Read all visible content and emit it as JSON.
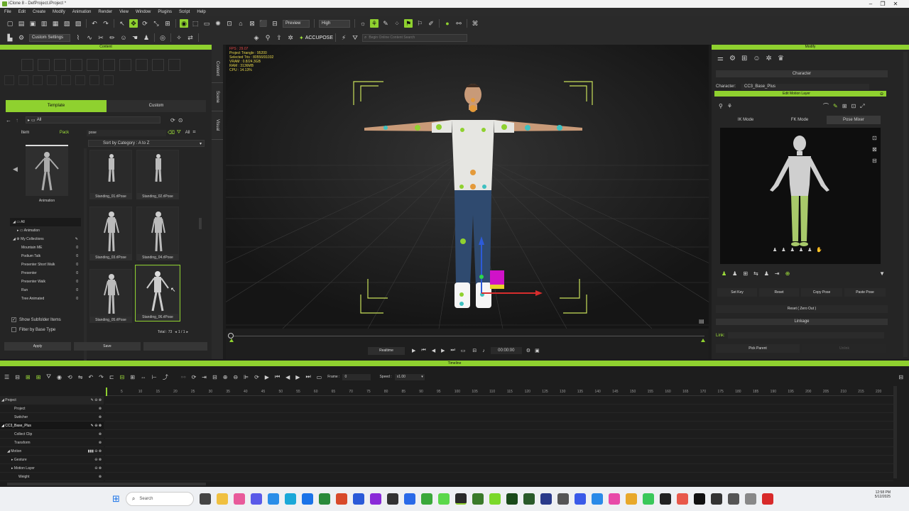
{
  "app": {
    "title": "iClone 8 - DefProject.iProject *",
    "window_controls": [
      "–",
      "❐",
      "✕"
    ]
  },
  "menu": [
    "File",
    "Edit",
    "Create",
    "Modify",
    "Animation",
    "Render",
    "View",
    "Window",
    "Plugins",
    "Script",
    "Help"
  ],
  "toolbar1": {
    "preview_label": "Preview",
    "quality_label": "High"
  },
  "toolbar2": {
    "settings_label": "Custom Settings",
    "accupose_label": "ACCUPOSE",
    "search_placeholder": "Begin Online Content Search"
  },
  "content": {
    "header": "Content",
    "tab_template": "Template",
    "tab_custom": "Custom",
    "path": "All",
    "filter_item": "Item",
    "filter_pack": "Pack",
    "search_value": "pose",
    "all_label": "All",
    "sort_label": "Sort by Category : A to Z",
    "preview_caption": "Animation",
    "tree": [
      {
        "label": "All",
        "count": ""
      },
      {
        "label": "Animation",
        "count": ""
      },
      {
        "label": "My Collections",
        "count": ""
      },
      {
        "label": "Mountain ME",
        "count": "0"
      },
      {
        "label": "Podium Talk",
        "count": "0"
      },
      {
        "label": "Presenter Short Walk",
        "count": "0"
      },
      {
        "label": "Presenter",
        "count": "0"
      },
      {
        "label": "Presenter Walk",
        "count": "0"
      },
      {
        "label": "Run",
        "count": "0"
      },
      {
        "label": "Tree Animated",
        "count": "0"
      }
    ],
    "items": [
      "Standing_01.rlPose",
      "Standing_02.rlPose",
      "Standing_03.rlPose",
      "Standing_04.rlPose",
      "Standing_05.rlPose",
      "Standing_06.rlPose"
    ],
    "show_subfolder": "Show Subfolder Items",
    "filter_base": "Filter by Base Type",
    "total": "Total : 73",
    "pages": "1 / 1",
    "apply": "Apply",
    "save": "Save",
    "side_tabs": [
      "Content",
      "Scene",
      "Visual"
    ]
  },
  "viewport": {
    "stats": [
      "FPS : 29.07",
      "Project Triangle : 95200",
      "Selected Tris : 80556/91032",
      "VRAM : 0.8/24.3GB",
      "RAM : 3136MB",
      "CPU : 14.13%"
    ]
  },
  "playbar": {
    "realtime": "Realtime",
    "time": "00:00:00"
  },
  "modify": {
    "header": "Modify",
    "character_section": "Character",
    "character_label": "Character:",
    "character_value": "CC3_Base_Plus",
    "edit_motion_layer": "Edit Motion Layer",
    "modes": [
      "IK Mode",
      "FK Mode",
      "Pose Mixer"
    ],
    "buttons": [
      "Set Key",
      "Reset",
      "Copy Pose",
      "Paste Pose"
    ],
    "reset_zero": "Reset ( Zero Out )",
    "linkage": "Linkage",
    "link_label": "Link:",
    "pick_parent": "Pick Parent",
    "unlink": "Unlink"
  },
  "timeline": {
    "header": "Timeline",
    "frame_label": "Frame :",
    "frame_value": "0",
    "speed_label": "Speed :",
    "speed_value": "x1.00",
    "ticks": [
      "5",
      "10",
      "15",
      "20",
      "25",
      "30",
      "35",
      "40",
      "45",
      "50",
      "55",
      "60",
      "65",
      "70",
      "75",
      "80",
      "85",
      "90",
      "95",
      "100",
      "105",
      "110",
      "115",
      "120",
      "125",
      "130",
      "135",
      "140",
      "145",
      "150",
      "155",
      "160",
      "165",
      "170",
      "175",
      "180",
      "185",
      "190",
      "195",
      "200",
      "205",
      "210",
      "215",
      "220"
    ],
    "tracks": [
      {
        "label": "Project",
        "level": 0,
        "bold": true
      },
      {
        "label": "Project",
        "level": 1,
        "bold": false
      },
      {
        "label": "Switcher",
        "level": 1,
        "bold": false
      },
      {
        "label": "CC3_Base_Plus",
        "level": 0,
        "bold": true
      },
      {
        "label": "Collect Clip",
        "level": 1,
        "bold": false
      },
      {
        "label": "Transform",
        "level": 1,
        "bold": false
      },
      {
        "label": "Motion",
        "level": 1,
        "bold": false
      },
      {
        "label": "Gesture",
        "level": 1,
        "bold": false
      },
      {
        "label": "Motion Layer",
        "level": 1,
        "bold": false
      },
      {
        "label": "Weight",
        "level": 1,
        "bold": false
      }
    ]
  },
  "taskbar": {
    "search_placeholder": "Search",
    "time": "12:58 PM",
    "date": "5/12/2025"
  },
  "colors": {
    "accent": "#8fd12f",
    "panel": "#252525"
  }
}
